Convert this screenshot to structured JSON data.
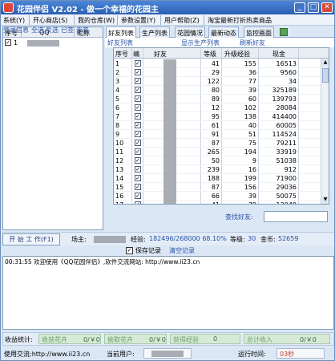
{
  "title": "花园伴侣 V2.02 - 做一个幸福的花园主",
  "menu": [
    "系统(Y)",
    "开心商店(S)",
    "我的仓库(W)",
    "参数设置(Y)",
    "用户帮助(Z)",
    "淘宝最新打折热卖商品"
  ],
  "left": {
    "headers": [
      "序号",
      "QQ",
      "昵称"
    ],
    "row_num": "1",
    "buttons": [
      "登录信息",
      "全选",
      "反选",
      "已签",
      "未签"
    ]
  },
  "tabs": [
    "好友列表",
    "生产列表",
    "花园情况",
    "最新动态",
    "监控画面"
  ],
  "subtabs": {
    "list": "好友列表",
    "show": "显示生产列表",
    "refresh": "刷新好友"
  },
  "grid": {
    "headers": [
      "序号",
      "编",
      "好友",
      "等级",
      "升级经验",
      "现金"
    ],
    "rows": [
      {
        "n": "1",
        "lvl": "41",
        "exp": "155",
        "cash": "16513"
      },
      {
        "n": "2",
        "lvl": "29",
        "exp": "36",
        "cash": "9560"
      },
      {
        "n": "3",
        "lvl": "122",
        "exp": "77",
        "cash": "34"
      },
      {
        "n": "4",
        "lvl": "80",
        "exp": "39",
        "cash": "325189"
      },
      {
        "n": "5",
        "lvl": "89",
        "exp": "60",
        "cash": "139793"
      },
      {
        "n": "6",
        "lvl": "12",
        "exp": "102",
        "cash": "28084"
      },
      {
        "n": "7",
        "lvl": "95",
        "exp": "138",
        "cash": "414400"
      },
      {
        "n": "8",
        "lvl": "61",
        "exp": "40",
        "cash": "60005"
      },
      {
        "n": "9",
        "lvl": "91",
        "exp": "51",
        "cash": "114524"
      },
      {
        "n": "10",
        "lvl": "87",
        "exp": "75",
        "cash": "79211"
      },
      {
        "n": "11",
        "lvl": "265",
        "exp": "194",
        "cash": "33919"
      },
      {
        "n": "12",
        "lvl": "50",
        "exp": "9",
        "cash": "51038"
      },
      {
        "n": "13",
        "lvl": "239",
        "exp": "16",
        "cash": "912"
      },
      {
        "n": "14",
        "lvl": "188",
        "exp": "199",
        "cash": "71900"
      },
      {
        "n": "15",
        "lvl": "87",
        "exp": "156",
        "cash": "29036"
      },
      {
        "n": "16",
        "lvl": "66",
        "exp": "39",
        "cash": "50075"
      },
      {
        "n": "17",
        "lvl": "41",
        "exp": "79",
        "cash": "13040"
      }
    ]
  },
  "search_label": "查找好友:",
  "status": {
    "start": "开 始 工 作(F1)",
    "owner_label": "场主:",
    "exp_label": "经验:",
    "exp_value": "182496/268000 68.10%",
    "level_label": "等级:",
    "level_value": "30",
    "gold_label": "金币:",
    "gold_value": "52659"
  },
  "log": {
    "save_label": "保存记录",
    "clear_label": "清空记录",
    "line": "00:31:55 欢迎使用《QQ花园伴侣》,软件交流网站: http://www.ii23.cn"
  },
  "income": {
    "label": "收益统计:",
    "harvest": "收获花卉",
    "harvest_val": "0/￥0",
    "pick": "偷取花卉",
    "pick_val": "0/￥0",
    "gain": "获得经验",
    "gain_val": "0",
    "total": "总计收入",
    "total_val": "0/￥0"
  },
  "footer": {
    "site_label": "使用交流:http://www.ii23.cn",
    "user_label": "当前用户:",
    "time_label": "运行时间:",
    "time_value": "03秒"
  }
}
